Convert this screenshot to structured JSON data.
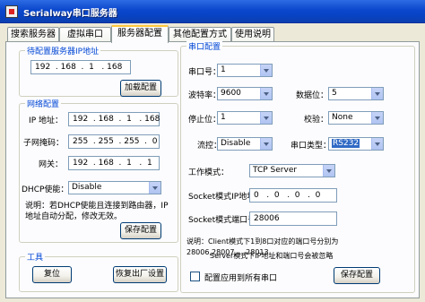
{
  "window": {
    "title": "Serialway串口服务器"
  },
  "tabs": [
    "搜索服务器",
    "虚拟串口",
    "服务器配置",
    "其他配置方式",
    "使用说明"
  ],
  "server_ip_group": {
    "title": "待配置服务器IP地址",
    "ip": "192  . 168  .  1   . 168",
    "load_button": "加载配置"
  },
  "network_group": {
    "title": "网络配置",
    "ip_label": "IP 地址：",
    "ip_value": "192  . 168  .  1   . 168",
    "mask_label": "子网掩码：",
    "mask_value": "255  . 255  . 255  .  0",
    "gateway_label": "网关：",
    "gateway_value": "192  . 168  .  1   .  1",
    "dhcp_label": "DHCP使能：",
    "dhcp_value": "Disable",
    "note": "说明：若DHCP使能且连接到路由器，IP地址自动分配，修改无效。",
    "save_button": "保存配置"
  },
  "tools_group": {
    "title": "工具",
    "reset_button": "复位",
    "factory_button": "恢复出厂设置"
  },
  "serial_group": {
    "title": "串口配置",
    "port_label": "串口号：",
    "port_value": "1",
    "baud_label": "波特率：",
    "baud_value": "9600",
    "databits_label": "数据位：",
    "databits_value": "5",
    "stopbits_label": "停止位：",
    "stopbits_value": "1",
    "parity_label": "校验：",
    "parity_value": "None",
    "flow_label": "流控：",
    "flow_value": "Disable",
    "porttype_label": "串口类型：",
    "porttype_value": "RS232",
    "workmode_label": "工作模式：",
    "workmode_value": "TCP Server",
    "socket_ip_label": "Socket模式IP地址:",
    "socket_ip_value": "0   .  0   .  0   .  0",
    "socket_port_label": "Socket模式端口号：",
    "socket_port_value": "28006",
    "note_line1": "说明：Client模式下1到8口对应的端口号分别为28006,28007,...,28013",
    "note_line2": "Server模式下IP地址和端口号会被忽略",
    "apply_all_label": "配置应用到所有串口",
    "save_button": "保存配置"
  },
  "colors": {
    "titlebar": "#0a47cc",
    "group_title": "#0046d5",
    "tab_highlight": "#ffc83c"
  }
}
